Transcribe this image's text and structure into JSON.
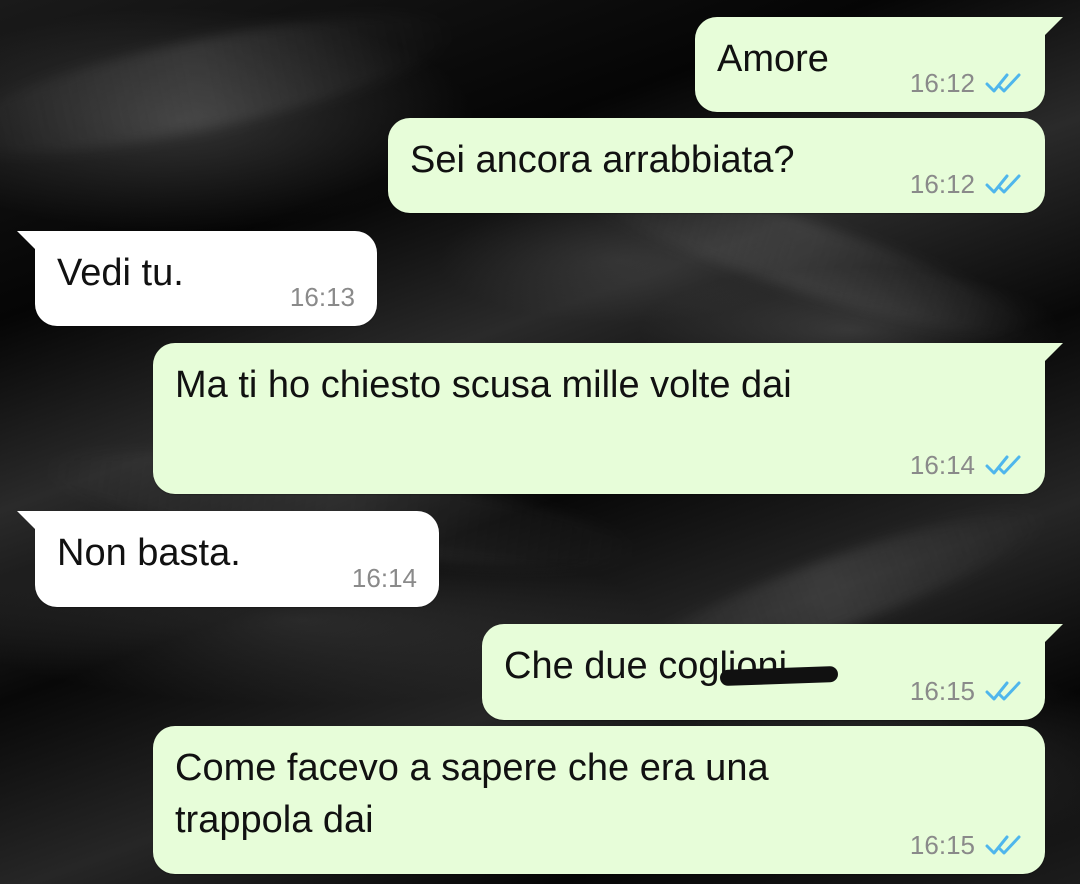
{
  "messages": [
    {
      "id": 1,
      "direction": "out",
      "text": "Amore",
      "time": "16:12",
      "status": "read"
    },
    {
      "id": 2,
      "direction": "out",
      "text": "Sei ancora arrabbiata?",
      "time": "16:12",
      "status": "read"
    },
    {
      "id": 3,
      "direction": "in",
      "text": "Vedi tu.",
      "time": "16:13"
    },
    {
      "id": 4,
      "direction": "out",
      "text": "Ma ti ho chiesto scusa mille volte dai",
      "time": "16:14",
      "status": "read"
    },
    {
      "id": 5,
      "direction": "in",
      "text": "Non basta.",
      "time": "16:14"
    },
    {
      "id": 6,
      "direction": "out",
      "text": "Che due coglioni",
      "time": "16:15",
      "status": "read",
      "note": "partially scribbled out"
    },
    {
      "id": 7,
      "direction": "out",
      "text": "Come facevo a sapere che era una\ntrappola dai",
      "time": "16:15",
      "status": "read"
    }
  ],
  "colors": {
    "outgoing_bubble": "#e7fdd9",
    "incoming_bubble": "#ffffff",
    "read_ticks": "#4fb6ec",
    "time_text": "#8a8a8a"
  },
  "icons": {
    "read_receipt": "double-check-icon"
  }
}
